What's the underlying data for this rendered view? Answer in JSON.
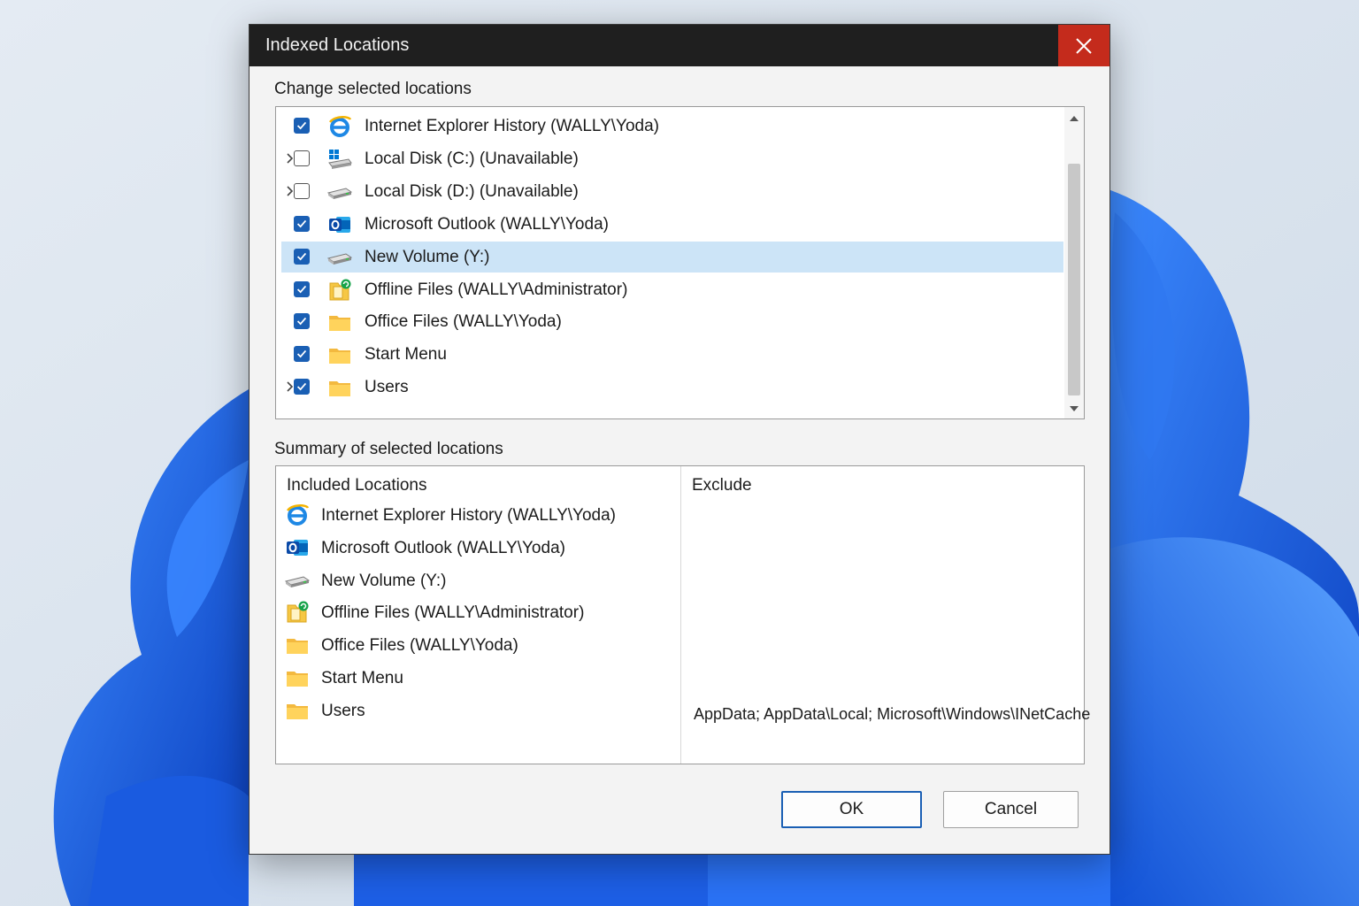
{
  "window": {
    "title": "Indexed Locations",
    "close_icon": "close-icon"
  },
  "change_section": {
    "label": "Change selected locations",
    "items": [
      {
        "label": "Internet Explorer History (WALLY\\Yoda)",
        "checked": true,
        "expandable": false,
        "icon": "internet-explorer-icon",
        "selected": false
      },
      {
        "label": "Local Disk (C:) (Unavailable)",
        "checked": false,
        "expandable": true,
        "icon": "windows-drive-icon",
        "selected": false
      },
      {
        "label": "Local Disk (D:) (Unavailable)",
        "checked": false,
        "expandable": true,
        "icon": "drive-icon",
        "selected": false
      },
      {
        "label": "Microsoft Outlook (WALLY\\Yoda)",
        "checked": true,
        "expandable": false,
        "icon": "outlook-icon",
        "selected": false
      },
      {
        "label": "New Volume (Y:)",
        "checked": true,
        "expandable": false,
        "icon": "drive-icon",
        "selected": true
      },
      {
        "label": "Offline Files (WALLY\\Administrator)",
        "checked": true,
        "expandable": false,
        "icon": "offline-files-icon",
        "selected": false
      },
      {
        "label": "Office Files (WALLY\\Yoda)",
        "checked": true,
        "expandable": false,
        "icon": "folder-icon",
        "selected": false
      },
      {
        "label": "Start Menu",
        "checked": true,
        "expandable": false,
        "icon": "folder-icon",
        "selected": false
      },
      {
        "label": "Users",
        "checked": true,
        "expandable": true,
        "icon": "folder-icon",
        "selected": false
      }
    ]
  },
  "summary_section": {
    "label": "Summary of selected locations",
    "included_header": "Included Locations",
    "exclude_header": "Exclude",
    "included": [
      {
        "label": "Internet Explorer History (WALLY\\Yoda)",
        "icon": "internet-explorer-icon"
      },
      {
        "label": "Microsoft Outlook (WALLY\\Yoda)",
        "icon": "outlook-icon"
      },
      {
        "label": "New Volume (Y:)",
        "icon": "drive-icon"
      },
      {
        "label": "Offline Files (WALLY\\Administrator)",
        "icon": "offline-files-icon"
      },
      {
        "label": "Office Files (WALLY\\Yoda)",
        "icon": "folder-icon"
      },
      {
        "label": "Start Menu",
        "icon": "folder-icon"
      },
      {
        "label": "Users",
        "icon": "folder-icon"
      }
    ],
    "exclude_users": "AppData; AppData\\Local; Microsoft\\Windows\\INetCache"
  },
  "buttons": {
    "ok": "OK",
    "cancel": "Cancel"
  },
  "colors": {
    "accent": "#1a5fb4",
    "close": "#c42b1c",
    "selection": "#cce4f7",
    "titlebar": "#1f1f1f"
  }
}
